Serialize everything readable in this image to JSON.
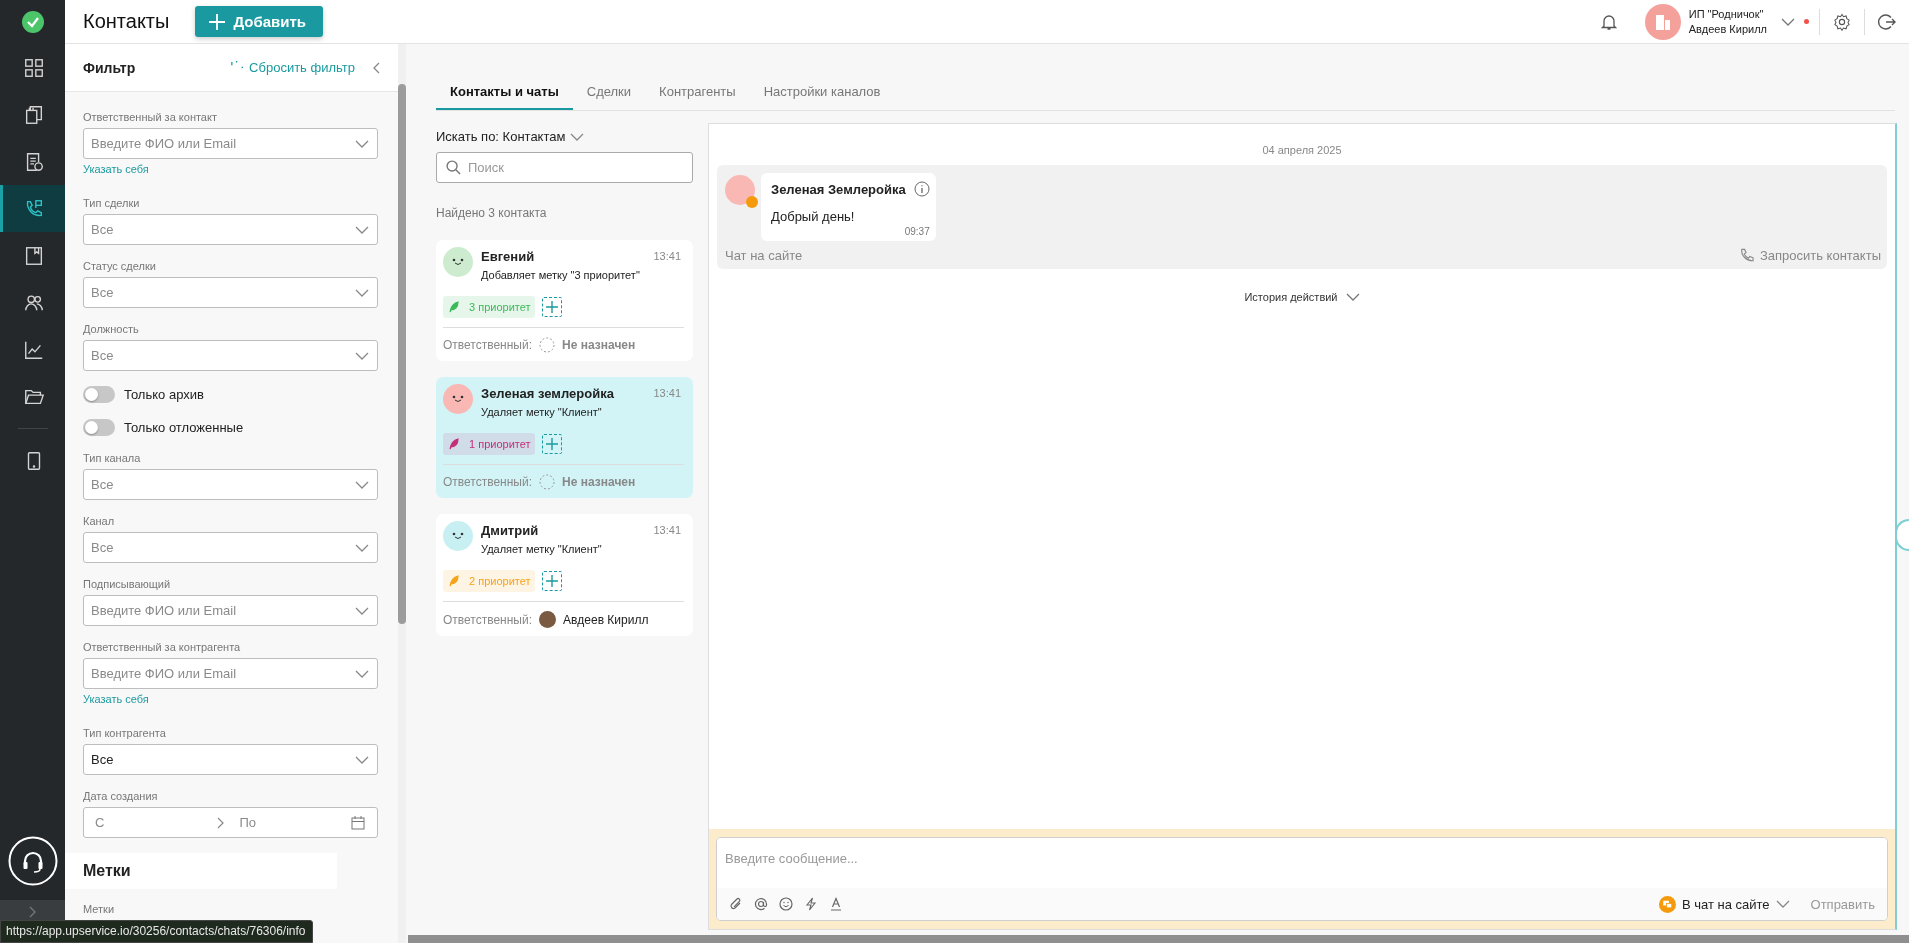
{
  "nav": {
    "items": [
      {
        "selected": false
      },
      {
        "selected": false
      },
      {
        "selected": false
      },
      {
        "selected": true
      },
      {
        "selected": false
      },
      {
        "selected": false
      },
      {
        "selected": false
      },
      {
        "selected": false
      },
      {
        "selected": false
      }
    ]
  },
  "header": {
    "title": "Контакты",
    "add_button": "Добавить",
    "company": "ИП \"Родничок\"",
    "user": "Авдеев Кирилл",
    "notification_dot": true
  },
  "filter": {
    "title": "Фильтр",
    "reset": "Сбросить фильтр",
    "fields": [
      {
        "kind": "select",
        "label": "Ответственный за контакт",
        "placeholder": "Введите ФИО или Email",
        "link": "Указать себя"
      },
      {
        "kind": "select",
        "label": "Тип сделки",
        "placeholder": "Все"
      },
      {
        "kind": "select",
        "label": "Статус сделки",
        "placeholder": "Все"
      },
      {
        "kind": "select",
        "label": "Должность",
        "placeholder": "Все"
      },
      {
        "kind": "toggle",
        "label": "Только архив",
        "on": false
      },
      {
        "kind": "toggle",
        "label": "Только отложенные",
        "on": false
      },
      {
        "kind": "select",
        "label": "Тип канала",
        "placeholder": "Все"
      },
      {
        "kind": "select",
        "label": "Канал",
        "placeholder": "Все"
      },
      {
        "kind": "select",
        "label": "Подписывающий",
        "placeholder": "Введите ФИО или Email"
      },
      {
        "kind": "select",
        "label": "Ответственный за контрагента",
        "placeholder": "Введите ФИО или Email",
        "link": "Указать себя"
      },
      {
        "kind": "select",
        "label": "Тип контрагента",
        "value": "Все"
      },
      {
        "kind": "daterange",
        "label": "Дата создания",
        "from_placeholder": "С",
        "to_placeholder": "По"
      }
    ],
    "tags_title": "Метки",
    "tags_label": "Метки"
  },
  "tabs": [
    {
      "label": "Контакты и чаты",
      "selected": true
    },
    {
      "label": "Сделки",
      "selected": false
    },
    {
      "label": "Контрагенты",
      "selected": false
    },
    {
      "label": "Настройки каналов",
      "selected": false
    }
  ],
  "contacts_panel": {
    "search_by": "Искать по: Контактам",
    "search_placeholder": "Поиск",
    "found": "Найдено 3 контакта"
  },
  "contacts": [
    {
      "name": "Евгений",
      "time": "13:41",
      "action": "Добавляет метку \"3 приоритет\"",
      "avatar": {
        "color": "#cdeccf"
      },
      "tag": {
        "label": "3 приоритет",
        "color": "#3cb95a"
      },
      "assignee": {
        "kind": "none",
        "label": "Ответственный:",
        "name": "Не назначен"
      },
      "selected": false
    },
    {
      "name": "Зеленая землеройка",
      "time": "13:41",
      "action": "Удаляет метку \"Клиент\"",
      "avatar": {
        "color": "#f9b8b3"
      },
      "tag": {
        "label": "1 приоритет",
        "color": "#c2307a"
      },
      "assignee": {
        "kind": "none",
        "label": "Ответственный:",
        "name": "Не назначен"
      },
      "selected": true
    },
    {
      "name": "Дмитрий",
      "time": "13:41",
      "action": "Удаляет метку \"Клиент\"",
      "avatar": {
        "color": "#c8f0f2"
      },
      "tag": {
        "label": "2 приоритет",
        "color": "#f5a31a"
      },
      "assignee": {
        "kind": "user",
        "label": "Ответственный:",
        "name": "Авдеев Кирилл"
      },
      "selected": false
    }
  ],
  "chat": {
    "date": "04 апреля 2025",
    "messages": [
      {
        "author": "Зеленая Землеройка",
        "text": "Добрый день!",
        "time": "09:37"
      }
    ],
    "channel": "Чат на сайте",
    "request_contacts": "Запросить контакты",
    "history": "История действий",
    "composer": {
      "placeholder": "Введите сообщение...",
      "channel_button": "В чат на сайте",
      "send": "Отправить"
    }
  },
  "status_url": "https://app.upservice.io/30256/contacts/chats/76306/info"
}
